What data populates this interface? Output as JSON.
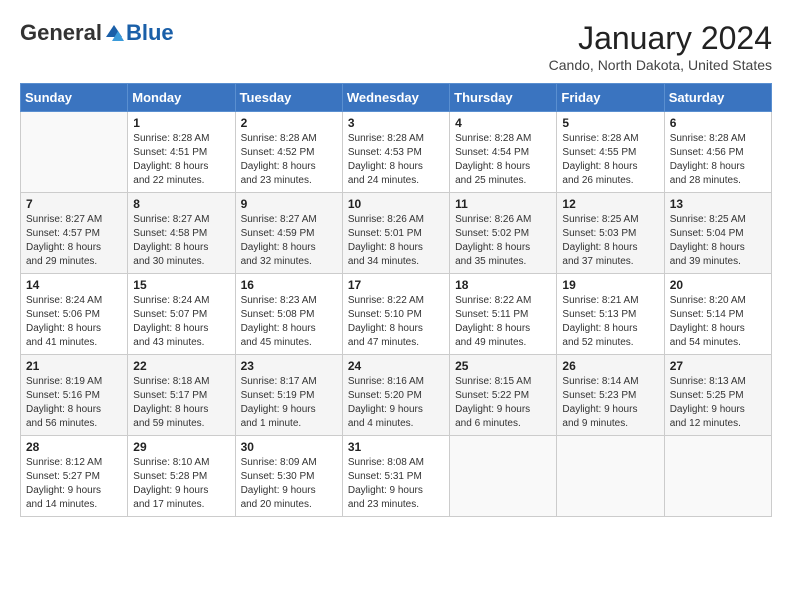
{
  "logo": {
    "general": "General",
    "blue": "Blue"
  },
  "title": "January 2024",
  "subtitle": "Cando, North Dakota, United States",
  "days_of_week": [
    "Sunday",
    "Monday",
    "Tuesday",
    "Wednesday",
    "Thursday",
    "Friday",
    "Saturday"
  ],
  "weeks": [
    [
      {
        "day": "",
        "info": ""
      },
      {
        "day": "1",
        "info": "Sunrise: 8:28 AM\nSunset: 4:51 PM\nDaylight: 8 hours\nand 22 minutes."
      },
      {
        "day": "2",
        "info": "Sunrise: 8:28 AM\nSunset: 4:52 PM\nDaylight: 8 hours\nand 23 minutes."
      },
      {
        "day": "3",
        "info": "Sunrise: 8:28 AM\nSunset: 4:53 PM\nDaylight: 8 hours\nand 24 minutes."
      },
      {
        "day": "4",
        "info": "Sunrise: 8:28 AM\nSunset: 4:54 PM\nDaylight: 8 hours\nand 25 minutes."
      },
      {
        "day": "5",
        "info": "Sunrise: 8:28 AM\nSunset: 4:55 PM\nDaylight: 8 hours\nand 26 minutes."
      },
      {
        "day": "6",
        "info": "Sunrise: 8:28 AM\nSunset: 4:56 PM\nDaylight: 8 hours\nand 28 minutes."
      }
    ],
    [
      {
        "day": "7",
        "info": "Sunrise: 8:27 AM\nSunset: 4:57 PM\nDaylight: 8 hours\nand 29 minutes."
      },
      {
        "day": "8",
        "info": "Sunrise: 8:27 AM\nSunset: 4:58 PM\nDaylight: 8 hours\nand 30 minutes."
      },
      {
        "day": "9",
        "info": "Sunrise: 8:27 AM\nSunset: 4:59 PM\nDaylight: 8 hours\nand 32 minutes."
      },
      {
        "day": "10",
        "info": "Sunrise: 8:26 AM\nSunset: 5:01 PM\nDaylight: 8 hours\nand 34 minutes."
      },
      {
        "day": "11",
        "info": "Sunrise: 8:26 AM\nSunset: 5:02 PM\nDaylight: 8 hours\nand 35 minutes."
      },
      {
        "day": "12",
        "info": "Sunrise: 8:25 AM\nSunset: 5:03 PM\nDaylight: 8 hours\nand 37 minutes."
      },
      {
        "day": "13",
        "info": "Sunrise: 8:25 AM\nSunset: 5:04 PM\nDaylight: 8 hours\nand 39 minutes."
      }
    ],
    [
      {
        "day": "14",
        "info": "Sunrise: 8:24 AM\nSunset: 5:06 PM\nDaylight: 8 hours\nand 41 minutes."
      },
      {
        "day": "15",
        "info": "Sunrise: 8:24 AM\nSunset: 5:07 PM\nDaylight: 8 hours\nand 43 minutes."
      },
      {
        "day": "16",
        "info": "Sunrise: 8:23 AM\nSunset: 5:08 PM\nDaylight: 8 hours\nand 45 minutes."
      },
      {
        "day": "17",
        "info": "Sunrise: 8:22 AM\nSunset: 5:10 PM\nDaylight: 8 hours\nand 47 minutes."
      },
      {
        "day": "18",
        "info": "Sunrise: 8:22 AM\nSunset: 5:11 PM\nDaylight: 8 hours\nand 49 minutes."
      },
      {
        "day": "19",
        "info": "Sunrise: 8:21 AM\nSunset: 5:13 PM\nDaylight: 8 hours\nand 52 minutes."
      },
      {
        "day": "20",
        "info": "Sunrise: 8:20 AM\nSunset: 5:14 PM\nDaylight: 8 hours\nand 54 minutes."
      }
    ],
    [
      {
        "day": "21",
        "info": "Sunrise: 8:19 AM\nSunset: 5:16 PM\nDaylight: 8 hours\nand 56 minutes."
      },
      {
        "day": "22",
        "info": "Sunrise: 8:18 AM\nSunset: 5:17 PM\nDaylight: 8 hours\nand 59 minutes."
      },
      {
        "day": "23",
        "info": "Sunrise: 8:17 AM\nSunset: 5:19 PM\nDaylight: 9 hours\nand 1 minute."
      },
      {
        "day": "24",
        "info": "Sunrise: 8:16 AM\nSunset: 5:20 PM\nDaylight: 9 hours\nand 4 minutes."
      },
      {
        "day": "25",
        "info": "Sunrise: 8:15 AM\nSunset: 5:22 PM\nDaylight: 9 hours\nand 6 minutes."
      },
      {
        "day": "26",
        "info": "Sunrise: 8:14 AM\nSunset: 5:23 PM\nDaylight: 9 hours\nand 9 minutes."
      },
      {
        "day": "27",
        "info": "Sunrise: 8:13 AM\nSunset: 5:25 PM\nDaylight: 9 hours\nand 12 minutes."
      }
    ],
    [
      {
        "day": "28",
        "info": "Sunrise: 8:12 AM\nSunset: 5:27 PM\nDaylight: 9 hours\nand 14 minutes."
      },
      {
        "day": "29",
        "info": "Sunrise: 8:10 AM\nSunset: 5:28 PM\nDaylight: 9 hours\nand 17 minutes."
      },
      {
        "day": "30",
        "info": "Sunrise: 8:09 AM\nSunset: 5:30 PM\nDaylight: 9 hours\nand 20 minutes."
      },
      {
        "day": "31",
        "info": "Sunrise: 8:08 AM\nSunset: 5:31 PM\nDaylight: 9 hours\nand 23 minutes."
      },
      {
        "day": "",
        "info": ""
      },
      {
        "day": "",
        "info": ""
      },
      {
        "day": "",
        "info": ""
      }
    ]
  ]
}
